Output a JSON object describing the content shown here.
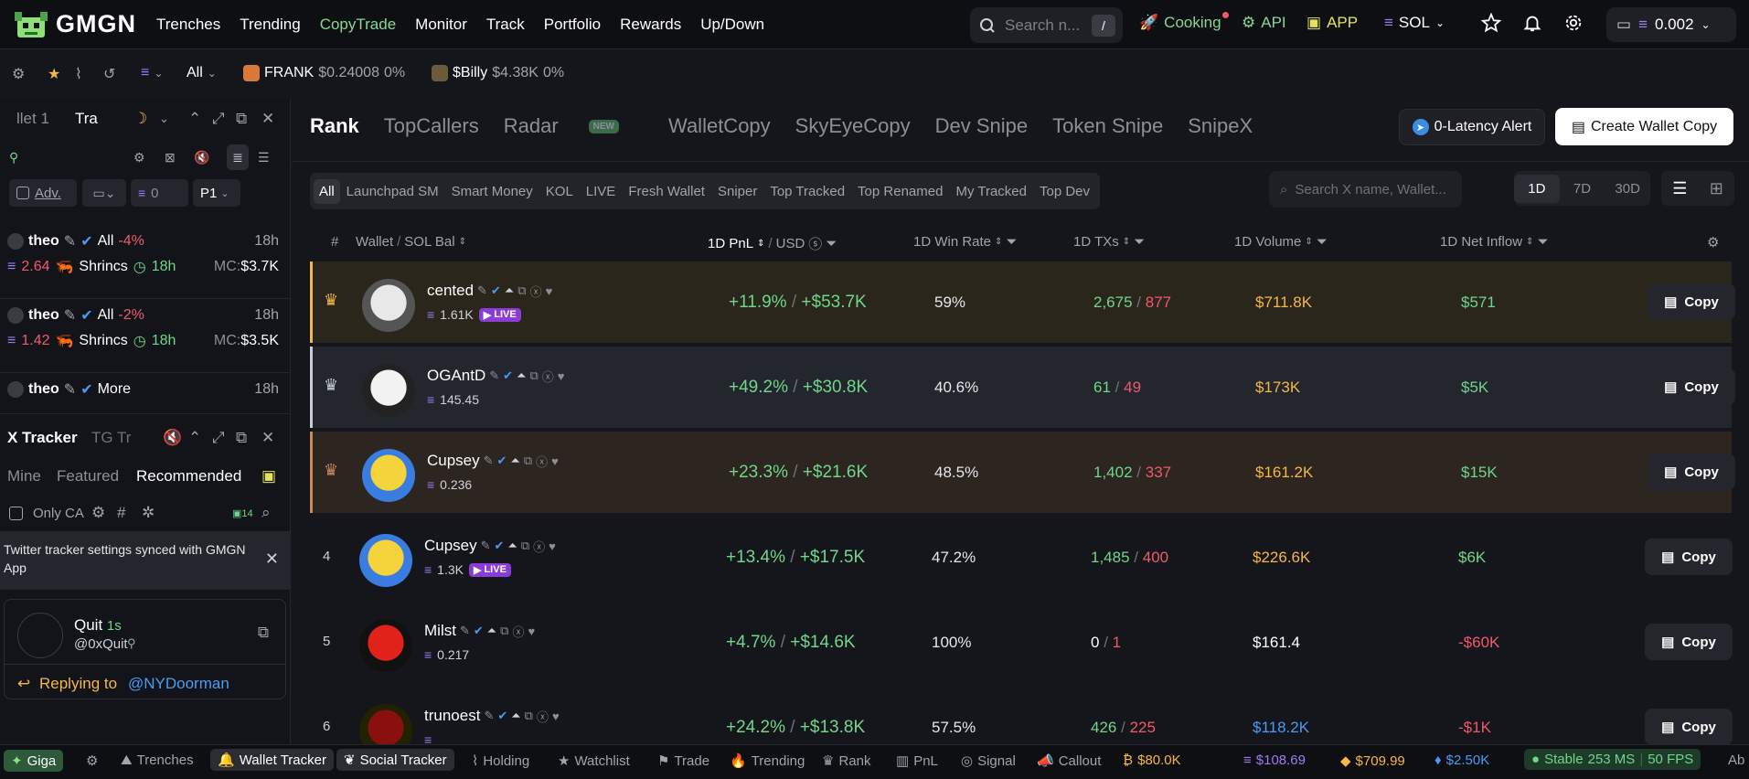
{
  "topnav": {
    "logo": "GMGN",
    "links": [
      "Trenches",
      "Trending",
      "CopyTrade",
      "Monitor",
      "Track",
      "Portfolio",
      "Rewards",
      "Up/Down"
    ],
    "active_link": "CopyTrade",
    "search_placeholder": "Search n...",
    "search_shortcut": "/",
    "cooking": "Cooking",
    "api": "API",
    "app": "APP",
    "chain": "SOL",
    "balance": "0.002"
  },
  "ticker": {
    "filter": "All",
    "items": [
      {
        "name": "FRANK",
        "price": "$0.24008",
        "change": "0%"
      },
      {
        "name": "$Billy",
        "price": "$4.38K",
        "change": "0%"
      }
    ]
  },
  "wallet_tracker": {
    "tab1": "llet 1",
    "tab2": "Tra",
    "adv": "Adv.",
    "amount": "0",
    "preset": "P1",
    "items": [
      {
        "user": "theo",
        "filter": "All",
        "change": "-4%",
        "time": "18h",
        "sol": "2.64",
        "token": "Shrincs",
        "age": "18h",
        "mc_label": "MC:",
        "mc": "$3.7K"
      },
      {
        "user": "theo",
        "filter": "All",
        "change": "-2%",
        "time": "18h",
        "sol": "1.42",
        "token": "Shrincs",
        "age": "18h",
        "mc_label": "MC:",
        "mc": "$3.5K"
      },
      {
        "user": "theo",
        "filter": "More",
        "change": "",
        "time": "18h"
      }
    ]
  },
  "x_tracker": {
    "title": "X Tracker",
    "tab2": "TG Tr",
    "subtabs": [
      "Mine",
      "Featured",
      "Recommended"
    ],
    "active_subtab": "Recommended",
    "only_ca": "Only CA",
    "count": "14",
    "notice": "Twitter tracker settings synced with GMGN App",
    "tweet": {
      "name": "Quit",
      "age": "1s",
      "handle": "@0xQuit",
      "replying_label": "Replying to",
      "replying_to": "@NYDoorman"
    }
  },
  "main": {
    "tabs": [
      "Rank",
      "TopCallers",
      "Radar",
      "WalletCopy",
      "SkyEyeCopy",
      "Dev Snipe",
      "Token Snipe",
      "SnipeX"
    ],
    "radar_badge": "NEW",
    "alert_button": "0-Latency Alert",
    "create_button": "Create Wallet Copy",
    "filters": [
      "All",
      "Launchpad SM",
      "Smart Money",
      "KOL",
      "LIVE",
      "Fresh Wallet",
      "Sniper",
      "Top Tracked",
      "Top Renamed",
      "My Tracked",
      "Top Dev"
    ],
    "x_search_placeholder": "Search X name, Wallet...",
    "periods": [
      "1D",
      "7D",
      "30D"
    ],
    "columns": {
      "rank": "#",
      "wallet": "Wallet",
      "sol_bal": "SOL Bal",
      "pnl": "1D PnL",
      "usd": "USD",
      "winrate": "1D Win Rate",
      "txs": "1D TXs",
      "volume": "1D Volume",
      "netflow": "1D Net Inflow"
    },
    "copy_label": "Copy",
    "rows": [
      {
        "rank": "",
        "name": "cented",
        "bal": "1.61K",
        "live": true,
        "pnl_pct": "+11.9%",
        "pnl_usd": "+$53.7K",
        "win": "59%",
        "buys": "2,675",
        "sells": "877",
        "volume": "$711.8K",
        "vol_color": "#f5b746",
        "net": "$571",
        "net_color": "#6fd68a",
        "bg": "#2a261c",
        "accent": "#f5b746"
      },
      {
        "rank": "",
        "name": "OGAntD",
        "bal": "145.45",
        "live": false,
        "pnl_pct": "+49.2%",
        "pnl_usd": "+$30.8K",
        "win": "40.6%",
        "buys": "61",
        "sells": "49",
        "volume": "$173K",
        "vol_color": "#f5b746",
        "net": "$5K",
        "net_color": "#6fd68a",
        "bg": "#24262e",
        "accent": "#c7ccd9"
      },
      {
        "rank": "",
        "name": "Cupsey",
        "bal": "0.236",
        "live": false,
        "pnl_pct": "+23.3%",
        "pnl_usd": "+$21.6K",
        "win": "48.5%",
        "buys": "1,402",
        "sells": "337",
        "volume": "$161.2K",
        "vol_color": "#f5b746",
        "net": "$15K",
        "net_color": "#6fd68a",
        "bg": "#2c2520",
        "accent": "#c98a5a"
      },
      {
        "rank": "4",
        "name": "Cupsey",
        "bal": "1.3K",
        "live": true,
        "pnl_pct": "+13.4%",
        "pnl_usd": "+$17.5K",
        "win": "47.2%",
        "buys": "1,485",
        "sells": "400",
        "volume": "$226.6K",
        "vol_color": "#f5b746",
        "net": "$6K",
        "net_color": "#6fd68a",
        "bg": "#15161b",
        "accent": ""
      },
      {
        "rank": "5",
        "name": "Milst",
        "bal": "0.217",
        "live": false,
        "pnl_pct": "+4.7%",
        "pnl_usd": "+$14.6K",
        "win": "100%",
        "buys": "0",
        "sells": "1",
        "volume": "$161.4",
        "vol_color": "#ffffff",
        "net": "-$60K",
        "net_color": "#f0596c",
        "bg": "#15161b",
        "accent": ""
      },
      {
        "rank": "6",
        "name": "trunoest",
        "bal": "",
        "live": false,
        "pnl_pct": "+24.2%",
        "pnl_usd": "+$13.8K",
        "win": "57.5%",
        "buys": "426",
        "sells": "225",
        "volume": "$118.2K",
        "vol_color": "#4a9bf5",
        "net": "-$1K",
        "net_color": "#f0596c",
        "bg": "#15161b",
        "accent": ""
      }
    ]
  },
  "bottombar": {
    "giga": "Giga",
    "items": [
      "Trenches",
      "Wallet Tracker",
      "Social Tracker",
      "Holding",
      "Watchlist",
      "Trade",
      "Trending",
      "Rank",
      "PnL",
      "Signal",
      "Callout"
    ],
    "prices": [
      "$80.0K",
      "$108.69",
      "$709.99",
      "$2.50K"
    ],
    "status": "Stable",
    "latency": "253 MS",
    "fps": "50 FPS",
    "truncated": "Ab"
  },
  "colors": {
    "accent_green": "#88d693",
    "gain": "#6fd68a",
    "loss": "#f0596c",
    "gold": "#f5b746"
  }
}
